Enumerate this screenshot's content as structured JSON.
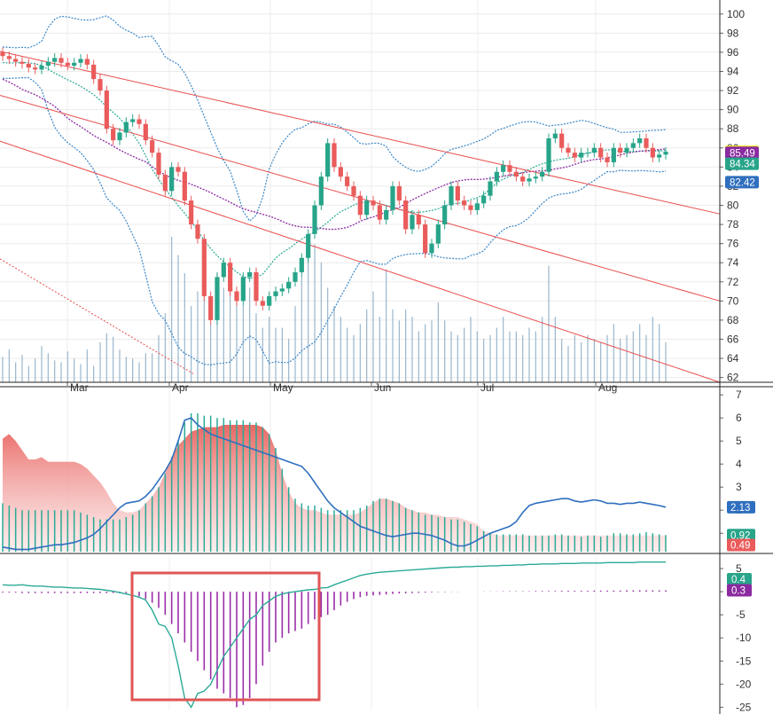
{
  "chart_data": [
    {
      "type": "candlestick",
      "panel": "price",
      "x_labels": [
        "Mar",
        "Apr",
        "May",
        "Jun",
        "Jul",
        "Aug"
      ],
      "y_ticks": [
        62,
        64,
        66,
        68,
        70,
        72,
        74,
        76,
        78,
        80,
        82,
        84,
        86,
        88,
        90,
        92,
        94,
        96,
        98,
        100
      ],
      "ylim": [
        61.5,
        101
      ],
      "grid": true,
      "value_badges": [
        "85.60",
        "85.49",
        "84.34",
        "82.42"
      ],
      "closes": [
        95.6,
        95.3,
        95.0,
        94.8,
        94.4,
        94.2,
        94.6,
        95.0,
        95.4,
        94.9,
        94.6,
        94.9,
        95.3,
        94.7,
        93.2,
        92.0,
        88.0,
        86.8,
        87.6,
        88.7,
        89.0,
        88.5,
        86.8,
        85.5,
        83.2,
        81.5,
        84.0,
        83.5,
        80.5,
        78.0,
        76.5,
        70.5,
        68.0,
        72.5,
        74.0,
        71.0,
        70.0,
        72.5,
        73.0,
        70.0,
        69.5,
        70.5,
        71.0,
        71.3,
        72.0,
        73.0,
        74.5,
        77.0,
        80.0,
        83.0,
        86.5,
        84.0,
        83.0,
        82.0,
        81.0,
        79.0,
        80.5,
        80.0,
        78.5,
        79.5,
        82.0,
        80.5,
        77.5,
        79.0,
        78.0,
        75.0,
        76.0,
        78.0,
        80.0,
        82.0,
        80.5,
        80.0,
        79.5,
        80.2,
        81.0,
        82.5,
        83.5,
        84.2,
        83.5,
        83.0,
        82.5,
        82.8,
        83.0,
        83.5,
        87.0,
        87.5,
        86.0,
        85.5,
        85.0,
        85.5,
        85.5,
        86.0,
        85.0,
        84.5,
        86.0,
        85.5,
        86.0,
        86.5,
        87.0,
        86.0,
        85.0,
        85.3,
        85.6
      ],
      "volume": [
        14,
        18,
        11,
        15,
        9,
        13,
        20,
        16,
        12,
        11,
        17,
        13,
        10,
        18,
        9,
        22,
        27,
        25,
        18,
        14,
        13,
        11,
        16,
        16,
        26,
        38,
        80,
        70,
        60,
        42,
        50,
        70,
        32,
        60,
        52,
        64,
        48,
        42,
        52,
        38,
        30,
        36,
        30,
        30,
        24,
        42,
        58,
        82,
        76,
        66,
        52,
        42,
        36,
        30,
        26,
        32,
        40,
        50,
        36,
        62,
        40,
        34,
        40,
        36,
        28,
        32,
        34,
        44,
        34,
        28,
        26,
        30,
        36,
        28,
        24,
        26,
        30,
        36,
        28,
        28,
        26,
        30,
        28,
        36,
        64,
        36,
        24,
        20,
        26,
        22,
        26,
        24,
        22,
        26,
        32,
        24,
        26,
        28,
        32,
        26,
        36,
        32,
        22
      ],
      "lines": [
        {
          "name": "upper band",
          "color": "#3a87c8"
        },
        {
          "name": "middle",
          "color": "#2aaa96"
        },
        {
          "name": "lower band",
          "color": "#3a87c8"
        },
        {
          "name": "slow average",
          "color": "#8b2aa0"
        }
      ],
      "trend_channel": [
        {
          "from": [
            0,
            96.1
          ],
          "to": [
            812,
            79.1
          ]
        },
        {
          "from": [
            0,
            91.5
          ],
          "to": [
            812,
            70.0
          ]
        },
        {
          "from": [
            0,
            86.7
          ],
          "to": [
            812,
            61.5
          ]
        }
      ]
    },
    {
      "type": "area+histogram+line",
      "panel": "indicator",
      "y_ticks": [
        1,
        2,
        3,
        4,
        5,
        6,
        7
      ],
      "ylim": [
        0.2,
        7.2
      ],
      "value_badges": [
        "2.13",
        "0.92",
        "0.49"
      ],
      "line": [
        0.4,
        0.35,
        0.3,
        0.3,
        0.3,
        0.35,
        0.4,
        0.45,
        0.5,
        0.5,
        0.55,
        0.6,
        0.7,
        0.8,
        0.95,
        1.2,
        1.5,
        1.8,
        2.1,
        2.3,
        2.35,
        2.4,
        2.6,
        2.9,
        3.3,
        3.7,
        4.2,
        5.0,
        5.9,
        6.0,
        5.7,
        5.5,
        5.3,
        5.2,
        5.1,
        5.0,
        4.9,
        4.8,
        4.7,
        4.6,
        4.5,
        4.4,
        4.3,
        4.2,
        4.1,
        4.0,
        3.9,
        3.6,
        3.2,
        2.8,
        2.4,
        2.1,
        1.9,
        1.7,
        1.5,
        1.3,
        1.2,
        1.1,
        1.0,
        0.9,
        0.85,
        0.9,
        0.95,
        1.0,
        1.0,
        0.95,
        0.9,
        0.8,
        0.7,
        0.55,
        0.45,
        0.45,
        0.55,
        0.7,
        0.85,
        1.0,
        1.1,
        1.2,
        1.3,
        1.5,
        1.9,
        2.2,
        2.3,
        2.35,
        2.4,
        2.45,
        2.5,
        2.5,
        2.4,
        2.35,
        2.4,
        2.45,
        2.4,
        2.3,
        2.3,
        2.25,
        2.3,
        2.3,
        2.35,
        2.3,
        2.25,
        2.2,
        2.13
      ],
      "area": [
        5.1,
        5.3,
        5.0,
        4.6,
        4.2,
        4.2,
        4.3,
        4.1,
        4.1,
        4.1,
        4.1,
        4.1,
        4.0,
        3.8,
        3.5,
        3.2,
        2.8,
        2.3,
        2.0,
        1.9,
        1.9,
        2.0,
        2.3,
        2.6,
        3.0,
        3.6,
        4.3,
        4.8,
        5.1,
        5.4,
        5.5,
        5.6,
        5.6,
        5.6,
        5.7,
        5.7,
        5.7,
        5.7,
        5.7,
        5.7,
        5.6,
        5.3,
        4.6,
        3.6,
        2.8,
        2.3,
        2.1,
        2.0,
        2.0,
        1.9,
        1.8,
        1.8,
        1.8,
        1.8,
        1.8,
        1.9,
        2.1,
        2.3,
        2.5,
        2.5,
        2.4,
        2.3,
        2.1,
        2.0,
        1.9,
        1.9,
        1.8,
        1.8,
        1.7,
        1.7,
        1.7,
        1.6,
        1.5,
        1.4,
        1.1,
        1.0,
        0.9,
        0.9,
        0.9,
        0.9,
        0.9,
        0.9,
        0.9,
        0.9,
        0.9,
        0.9,
        0.9,
        0.9,
        0.9,
        0.9,
        0.9,
        0.9,
        0.9,
        0.9,
        0.9,
        0.9,
        0.9,
        0.9,
        0.9,
        0.9,
        0.9,
        0.9,
        0.9
      ],
      "bars": [
        2.3,
        2.2,
        2.1,
        2.0,
        2.0,
        2.0,
        2.0,
        2.0,
        2.0,
        2.0,
        2.0,
        2.0,
        1.9,
        1.8,
        1.7,
        1.6,
        1.6,
        1.6,
        1.6,
        1.7,
        1.8,
        2.0,
        2.3,
        2.6,
        3.0,
        3.6,
        4.3,
        5.0,
        5.8,
        6.2,
        6.2,
        6.1,
        6.1,
        6.0,
        6.0,
        5.9,
        5.9,
        5.9,
        5.8,
        5.8,
        5.6,
        5.3,
        4.7,
        3.8,
        3.0,
        2.5,
        2.3,
        2.2,
        2.2,
        2.1,
        2.0,
        2.0,
        2.0,
        2.0,
        2.0,
        2.1,
        2.2,
        2.4,
        2.5,
        2.5,
        2.4,
        2.3,
        2.1,
        2.0,
        1.9,
        1.8,
        1.8,
        1.7,
        1.7,
        1.6,
        1.6,
        1.5,
        1.4,
        1.3,
        1.1,
        1.0,
        0.95,
        0.95,
        0.95,
        0.95,
        0.95,
        0.9,
        0.9,
        0.9,
        0.9,
        0.95,
        0.95,
        0.9,
        0.9,
        0.85,
        0.9,
        0.9,
        0.85,
        0.9,
        1.0,
        1.0,
        0.95,
        0.95,
        1.0,
        1.05,
        1.0,
        0.95,
        0.92
      ]
    },
    {
      "type": "line+histogram",
      "panel": "oscillator",
      "y_ticks": [
        5,
        0,
        -5,
        -10,
        -15,
        -20,
        -25
      ],
      "ylim": [
        -25.5,
        7.5
      ],
      "value_badges": [
        "0.4",
        "0.3"
      ],
      "line": [
        1.5,
        1.4,
        1.4,
        1.5,
        1.3,
        1.2,
        1.2,
        1.1,
        1.0,
        1.0,
        0.9,
        0.8,
        0.8,
        0.7,
        0.6,
        0.5,
        0.3,
        0.1,
        -0.2,
        -0.5,
        -0.8,
        -1.2,
        -1.8,
        -4.0,
        -7.0,
        -7.5,
        -10.0,
        -16.0,
        -23.0,
        -25.0,
        -22.0,
        -21.5,
        -20.0,
        -17.0,
        -14.0,
        -12.0,
        -10.0,
        -8.0,
        -6.0,
        -5.0,
        -3.0,
        -2.0,
        -1.0,
        -0.5,
        -0.2,
        0.0,
        0.2,
        0.4,
        0.5,
        0.8,
        0.9,
        1.5,
        2.0,
        2.5,
        3.0,
        3.5,
        3.8,
        4.0,
        4.2,
        4.3,
        4.4,
        4.5,
        4.6,
        4.7,
        4.8,
        4.9,
        5.0,
        5.1,
        5.2,
        5.3,
        5.3,
        5.4,
        5.4,
        5.5,
        5.5,
        5.6,
        5.6,
        5.7,
        5.7,
        5.8,
        5.8,
        5.9,
        5.9,
        6.0,
        6.0,
        6.0,
        6.1,
        6.1,
        6.1,
        6.2,
        6.2,
        6.2,
        6.2,
        6.3,
        6.3,
        6.3,
        6.3,
        6.3,
        6.4,
        6.4,
        6.4,
        6.4,
        6.4
      ],
      "bars": [
        -0.2,
        -0.2,
        -0.2,
        -0.3,
        -0.3,
        -0.3,
        -0.3,
        -0.3,
        -0.3,
        -0.3,
        -0.3,
        -0.3,
        -0.3,
        -0.3,
        -0.3,
        -0.3,
        -0.3,
        -0.3,
        -0.3,
        -0.3,
        -0.6,
        -1.0,
        -1.6,
        -2.4,
        -3.5,
        -5.0,
        -7.0,
        -9.0,
        -11.0,
        -13.0,
        -15.0,
        -17.0,
        -19.0,
        -21.0,
        -22.0,
        -23.0,
        -25.0,
        -24.5,
        -23.0,
        -20.0,
        -16.0,
        -13.0,
        -11.0,
        -10.0,
        -9.0,
        -8.5,
        -8.0,
        -7.0,
        -6.0,
        -5.5,
        -5.0,
        -4.0,
        -3.0,
        -2.2,
        -1.6,
        -1.2,
        -0.9,
        -0.8,
        -0.7,
        -0.6,
        -0.5,
        -0.4,
        -0.35,
        -0.3,
        -0.25,
        -0.2,
        -0.15,
        -0.1,
        -0.1,
        -0.05,
        -0.05,
        0.0,
        0.0,
        0.0,
        0.05,
        0.05,
        0.05,
        0.1,
        0.1,
        0.1,
        0.1,
        0.1,
        0.15,
        0.15,
        0.15,
        0.15,
        0.2,
        0.2,
        0.2,
        0.2,
        0.2,
        0.25,
        0.25,
        0.25,
        0.25,
        0.25,
        0.3,
        0.3,
        0.3,
        0.3,
        0.3,
        0.3,
        0.3
      ],
      "highlight_box": true
    }
  ]
}
